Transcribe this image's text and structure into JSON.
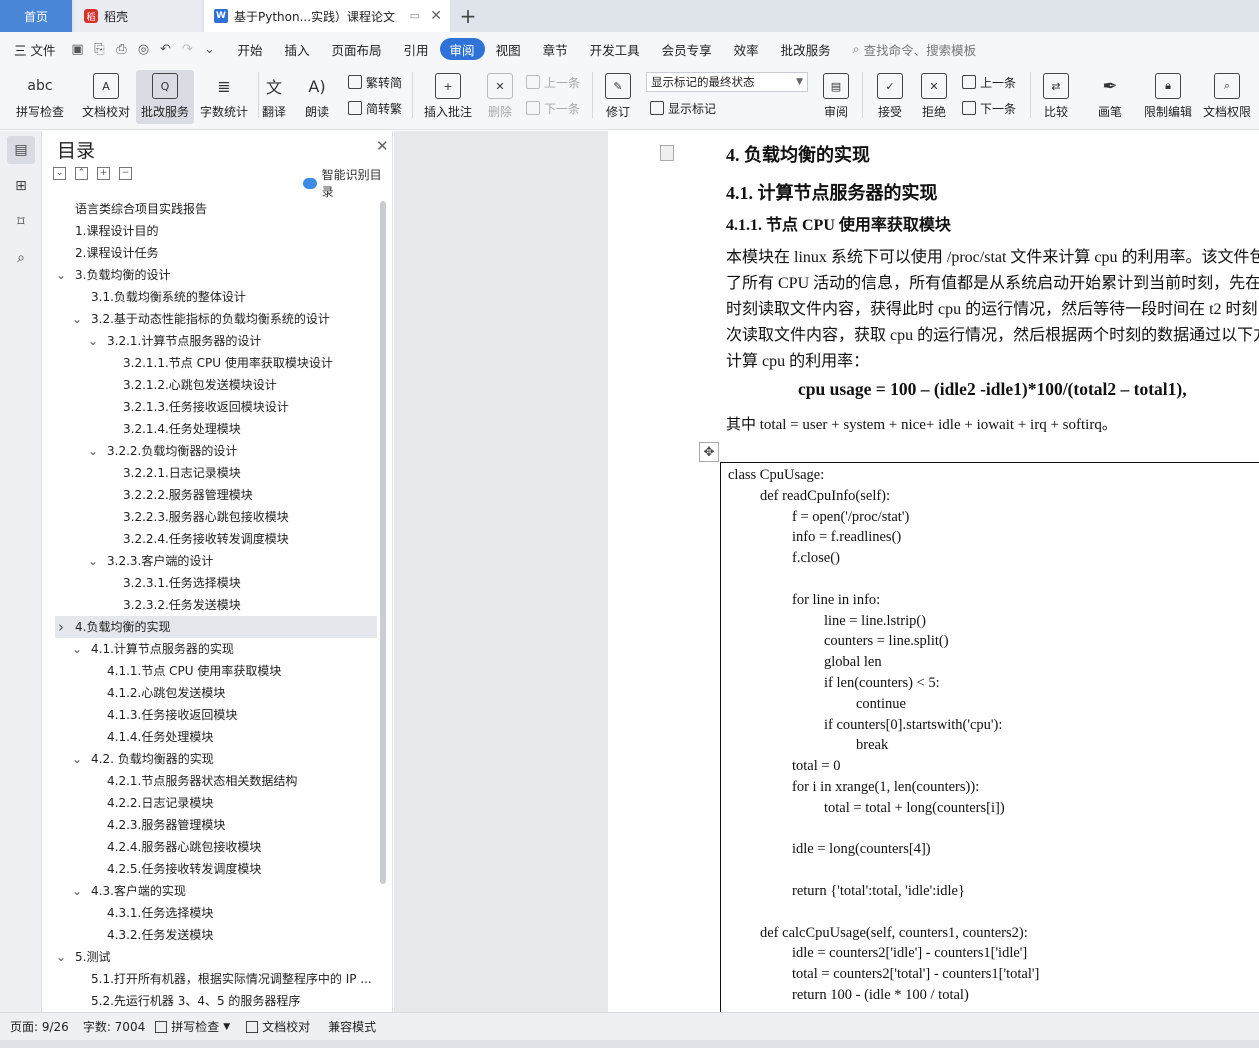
{
  "titlebar": {
    "tabs": [
      {
        "label": "首页"
      },
      {
        "label": "稻壳"
      },
      {
        "label": "基于Python...实践）课程论文"
      }
    ],
    "new_tab": "+",
    "close": "✕"
  },
  "menu": {
    "file": "三 文件",
    "items": [
      "开始",
      "插入",
      "页面布局",
      "引用",
      "审阅",
      "视图",
      "章节",
      "开发工具",
      "会员专享",
      "效率",
      "批改服务"
    ],
    "active": "审阅",
    "search": "查找命令、搜索模板"
  },
  "toolbar": {
    "buttons": [
      {
        "label": "拼写检查",
        "icon": "abc"
      },
      {
        "label": "文档校对",
        "icon": "A"
      },
      {
        "label": "批改服务",
        "icon": "Q"
      },
      {
        "label": "字数统计",
        "icon": "≣"
      },
      {
        "label": "翻译",
        "icon": "文"
      },
      {
        "label": "朗读",
        "icon": "A)"
      }
    ],
    "convert": [
      "繁转简",
      "简转繁"
    ],
    "comment": {
      "insert": "插入批注",
      "delete": "删除",
      "prev": "上一条",
      "next": "下一条"
    },
    "revise": {
      "label": "修订",
      "combo": "显示标记的最终状态",
      "show_marks": "显示标记"
    },
    "review_buttons": [
      {
        "label": "审阅"
      },
      {
        "label": "接受"
      },
      {
        "label": "拒绝"
      }
    ],
    "nav": {
      "prev": "上一条",
      "next": "下一条"
    },
    "right_buttons": [
      {
        "label": "比较"
      },
      {
        "label": "画笔"
      },
      {
        "label": "限制编辑"
      },
      {
        "label": "文档权限"
      }
    ]
  },
  "toc": {
    "title": "目录",
    "smart": "智能识别目录",
    "items": [
      {
        "text": "语言类综合项目实践报告",
        "level": 0,
        "caret": ""
      },
      {
        "text": "1.课程设计目的",
        "level": 0,
        "caret": ""
      },
      {
        "text": "2.课程设计任务",
        "level": 0,
        "caret": ""
      },
      {
        "text": "3.负载均衡的设计",
        "level": 0,
        "caret": "v"
      },
      {
        "text": "3.1.负载均衡系统的整体设计",
        "level": 1,
        "caret": ""
      },
      {
        "text": "3.2.基于动态性能指标的负载均衡系统的设计",
        "level": 1,
        "caret": "v"
      },
      {
        "text": "3.2.1.计算节点服务器的设计",
        "level": 2,
        "caret": "v"
      },
      {
        "text": "3.2.1.1.节点 CPU 使用率获取模块设计",
        "level": 3,
        "caret": ""
      },
      {
        "text": "3.2.1.2.心跳包发送模块设计",
        "level": 3,
        "caret": ""
      },
      {
        "text": "3.2.1.3.任务接收返回模块设计",
        "level": 3,
        "caret": ""
      },
      {
        "text": "3.2.1.4.任务处理模块",
        "level": 3,
        "caret": ""
      },
      {
        "text": "3.2.2.负载均衡器的设计",
        "level": 2,
        "caret": "v"
      },
      {
        "text": "3.2.2.1.日志记录模块",
        "level": 3,
        "caret": ""
      },
      {
        "text": "3.2.2.2.服务器管理模块",
        "level": 3,
        "caret": ""
      },
      {
        "text": "3.2.2.3.服务器心跳包接收模块",
        "level": 3,
        "caret": ""
      },
      {
        "text": "3.2.2.4.任务接收转发调度模块",
        "level": 3,
        "caret": ""
      },
      {
        "text": "3.2.3.客户端的设计",
        "level": 2,
        "caret": "v"
      },
      {
        "text": "3.2.3.1.任务选择模块",
        "level": 3,
        "caret": ""
      },
      {
        "text": "3.2.3.2.任务发送模块",
        "level": 3,
        "caret": ""
      },
      {
        "text": "4.负载均衡的实现",
        "level": 0,
        "caret": ">"
      },
      {
        "text": "4.1.计算节点服务器的实现",
        "level": 1,
        "caret": "v"
      },
      {
        "text": "4.1.1.节点 CPU 使用率获取模块",
        "level": 2,
        "caret": ""
      },
      {
        "text": "4.1.2.心跳包发送模块",
        "level": 2,
        "caret": ""
      },
      {
        "text": "4.1.3.任务接收返回模块",
        "level": 2,
        "caret": ""
      },
      {
        "text": "4.1.4.任务处理模块",
        "level": 2,
        "caret": ""
      },
      {
        "text": "4.2. 负载均衡器的实现",
        "level": 1,
        "caret": "v"
      },
      {
        "text": "4.2.1.节点服务器状态相关数据结构",
        "level": 2,
        "caret": ""
      },
      {
        "text": "4.2.2.日志记录模块",
        "level": 2,
        "caret": ""
      },
      {
        "text": "4.2.3.服务器管理模块",
        "level": 2,
        "caret": ""
      },
      {
        "text": "4.2.4.服务器心跳包接收模块",
        "level": 2,
        "caret": ""
      },
      {
        "text": "4.2.5.任务接收转发调度模块",
        "level": 2,
        "caret": ""
      },
      {
        "text": "4.3.客户端的实现",
        "level": 1,
        "caret": "v"
      },
      {
        "text": "4.3.1.任务选择模块",
        "level": 2,
        "caret": ""
      },
      {
        "text": "4.3.2.任务发送模块",
        "level": 2,
        "caret": ""
      },
      {
        "text": "5.测试",
        "level": 0,
        "caret": "v"
      },
      {
        "text": "5.1.打开所有机器，根据实际情况调整程序中的 IP ...",
        "level": 1,
        "caret": ""
      },
      {
        "text": "5.2.先运行机器 3、4、5 的服务器程序",
        "level": 1,
        "caret": ""
      }
    ],
    "selected_index": 19
  },
  "document": {
    "h1": "4.  负载均衡的实现",
    "h2": "4.1.  计算节点服务器的实现",
    "h3": "4.1.1.  节点 CPU 使用率获取模块",
    "para_lines": [
      "本模块在 linux 系统下可以使用 /proc/stat 文件来计算 cpu 的利用率。该文件包",
      "了所有 CPU 活动的信息，所有值都是从系统启动开始累计到当前时刻，先在",
      "时刻读取文件内容，获得此时 cpu 的运行情况，然后等待一段时间在 t2 时刻",
      "次读取文件内容，获取 cpu 的运行情况，然后根据两个时刻的数据通过以下方",
      "计算 cpu 的利用率："
    ],
    "formula": "cpu usage = 100 – (idle2 -idle1)*100/(total2 – total1),",
    "note": "其中 total = user + system + nice+ idle + iowait + irq + softirq。",
    "code": [
      {
        "t": "class CpuUsage:",
        "i": 0
      },
      {
        "t": "def readCpuInfo(self):",
        "i": 1
      },
      {
        "t": "f = open('/proc/stat')",
        "i": 2
      },
      {
        "t": "info = f.readlines()",
        "i": 2
      },
      {
        "t": "f.close()",
        "i": 2
      },
      {
        "t": "",
        "i": 0
      },
      {
        "t": "for line in info:",
        "i": 2
      },
      {
        "t": "line = line.lstrip()",
        "i": 3
      },
      {
        "t": "counters = line.split()",
        "i": 3
      },
      {
        "t": "global len",
        "i": 3
      },
      {
        "t": "if len(counters) < 5:",
        "i": 3
      },
      {
        "t": "continue",
        "i": 4
      },
      {
        "t": "if counters[0].startswith('cpu'):",
        "i": 3
      },
      {
        "t": "break",
        "i": 4
      },
      {
        "t": "total = 0",
        "i": 2
      },
      {
        "t": "for i in xrange(1, len(counters)):",
        "i": 2
      },
      {
        "t": "total = total + long(counters[i])",
        "i": 3
      },
      {
        "t": "",
        "i": 0
      },
      {
        "t": "idle = long(counters[4])",
        "i": 2
      },
      {
        "t": "",
        "i": 0
      },
      {
        "t": "return {'total':total, 'idle':idle}",
        "i": 2
      },
      {
        "t": "",
        "i": 0
      },
      {
        "t": "def calcCpuUsage(self, counters1, counters2):",
        "i": 1
      },
      {
        "t": "idle = counters2['idle'] - counters1['idle']",
        "i": 2
      },
      {
        "t": "total = counters2['total'] - counters1['total']",
        "i": 2
      },
      {
        "t": "return 100 - (idle * 100 / total)",
        "i": 2
      }
    ]
  },
  "status": {
    "page": "页面: 9/26",
    "words": "字数: 7004",
    "spell": "拼写检查",
    "proof": "文档校对",
    "compat": "兼容模式"
  }
}
